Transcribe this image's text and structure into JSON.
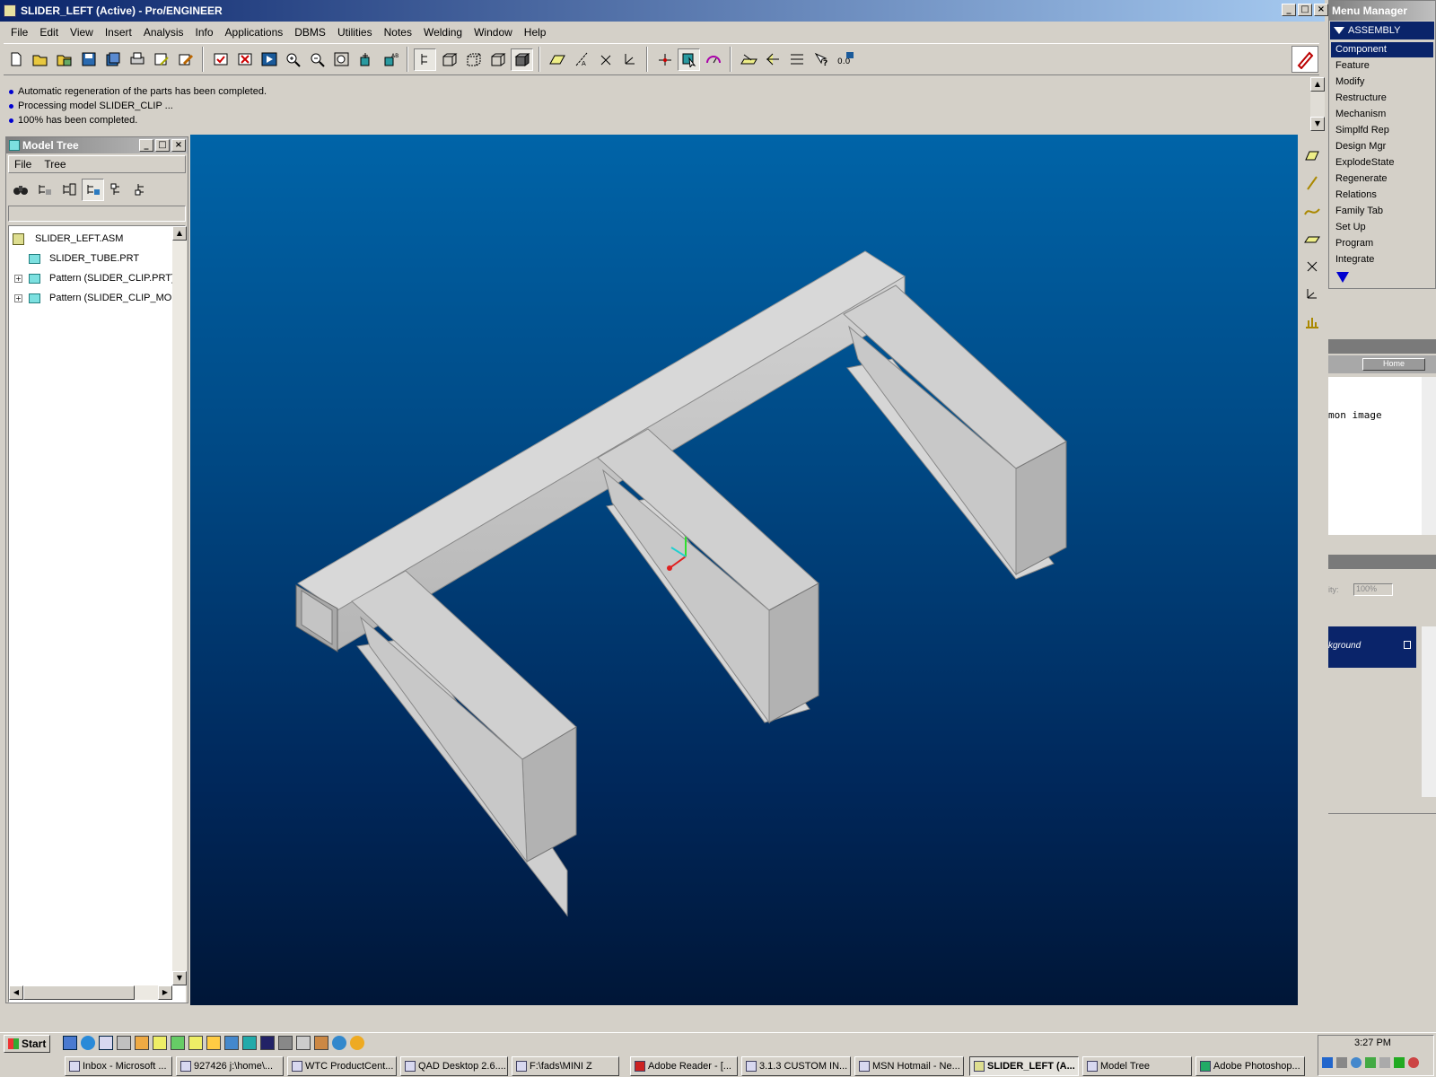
{
  "window": {
    "title": "SLIDER_LEFT (Active) - Pro/ENGINEER"
  },
  "menubar": [
    "File",
    "Edit",
    "View",
    "Insert",
    "Analysis",
    "Info",
    "Applications",
    "DBMS",
    "Utilities",
    "Notes",
    "Welding",
    "Window",
    "Help"
  ],
  "messages": [
    "Automatic regeneration of the parts has been completed.",
    "Processing model SLIDER_CLIP ...",
    "100% has been completed."
  ],
  "model_tree": {
    "title": "Model Tree",
    "menu": [
      "File",
      "Tree"
    ],
    "items": [
      "SLIDER_LEFT.ASM",
      "SLIDER_TUBE.PRT",
      "Pattern (SLIDER_CLIP.PRT)",
      "Pattern (SLIDER_CLIP_MOU"
    ]
  },
  "menu_manager": {
    "title": "Menu Manager",
    "header": "ASSEMBLY",
    "items": [
      "Component",
      "Feature",
      "Modify",
      "Restructure",
      "Mechanism",
      "Simplfd Rep",
      "Design Mgr",
      "ExplodeState",
      "Regenerate",
      "Relations",
      "Family Tab",
      "Set Up",
      "Program",
      "Integrate"
    ],
    "selected": "Component"
  },
  "bg_panel": {
    "home": "Home",
    "text1": "mon image",
    "opacity_label": "ity:",
    "opacity_value": "100%",
    "layer": "kground"
  },
  "taskbar": {
    "start": "Start",
    "tasks": [
      "Inbox - Microsoft ...",
      "927426  j:\\home\\...",
      "WTC ProductCent...",
      "QAD Desktop 2.6....",
      "F:\\fads\\MINI Z",
      "Adobe Reader - [...",
      "3.1.3 CUSTOM IN...",
      "MSN Hotmail - Ne...",
      "SLIDER_LEFT (A...",
      "Model Tree",
      "Adobe Photoshop..."
    ],
    "active": "SLIDER_LEFT (A...",
    "clock": "3:27 PM"
  }
}
